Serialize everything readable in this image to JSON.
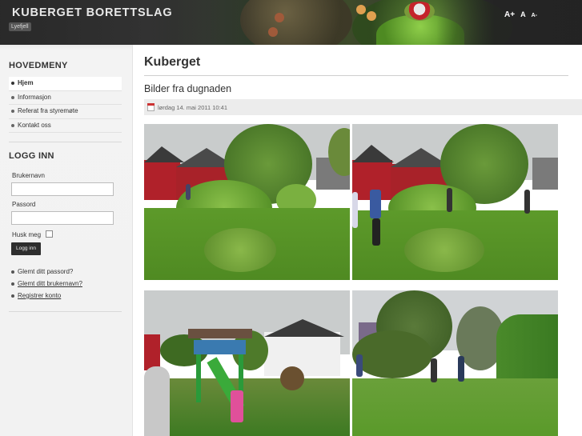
{
  "header": {
    "site_title": "KUBERGET BORETTSLAG",
    "site_tag": "Lyefjell",
    "font_tools": [
      "A+",
      "A",
      "A-"
    ]
  },
  "sidebar": {
    "menu_heading": "HOVEDMENY",
    "menu_items": [
      {
        "label": "Hjem",
        "active": true
      },
      {
        "label": "Informasjon",
        "active": false
      },
      {
        "label": "Referat fra styremøte",
        "active": false
      },
      {
        "label": "Kontakt oss",
        "active": false
      }
    ],
    "login_heading": "LOGG INN",
    "username_label": "Brukernavn",
    "username_value": "",
    "password_label": "Passord",
    "password_value": "",
    "remember_label": "Husk meg",
    "remember_checked": false,
    "login_button": "Logg inn",
    "links": [
      "Glemt ditt passord?",
      "Glemt ditt brukernavn?",
      "Registrer konto"
    ]
  },
  "main": {
    "page_title": "Kuberget",
    "article_title": "Bilder fra dugnaden",
    "date": "lørdag 14. mai 2011 10:41",
    "calendar_icon": "calendar-icon",
    "photos_count": 4
  },
  "colors": {
    "header_bg": "#3a3a3a",
    "sidebar_bg": "#f2f2f2",
    "button_bg": "#2e2e2e",
    "grass": "#5d9a2a",
    "house_red": "#b0212a"
  }
}
